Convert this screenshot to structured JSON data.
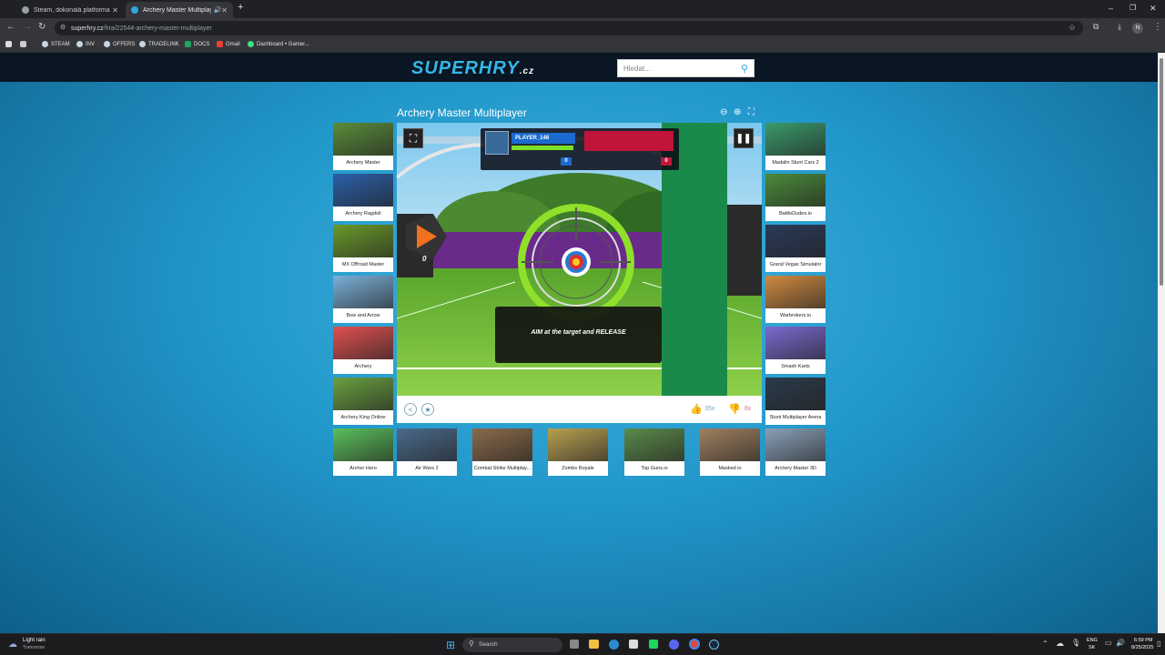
{
  "browser": {
    "tabs": [
      {
        "label": "Steam, dokonalá platforma pre",
        "active": false
      },
      {
        "label": "Archery Master Multiplaye",
        "active": true
      }
    ],
    "url_domain": "superhry.cz",
    "url_path": "/hra/22544-archery-master-multiplayer",
    "profile_initial": "N",
    "bookmarks": [
      "STEAM",
      "INV",
      "OFFERS",
      "TRADELINK",
      "DOCS",
      "Gmail",
      "Dashboard • Gamer..."
    ]
  },
  "site": {
    "logo": "SUPERHRY",
    "logo_suffix": ".cz",
    "search_placeholder": "Hledat..."
  },
  "game": {
    "title": "Archery Master Multiplayer",
    "player_name": "PLAYER_148",
    "player_score": "0",
    "opponent_score": "0",
    "left_counter": "0",
    "instruction": "AIM at the target and RELEASE",
    "likes": "35x",
    "dislikes": "8x"
  },
  "left_thumbs": [
    {
      "label": "Archery Master",
      "color": "#5a8c3a"
    },
    {
      "label": "Archery Ragdoll",
      "color": "#2a5fa8"
    },
    {
      "label": "MX Offroad Master",
      "color": "#6a9a2a"
    },
    {
      "label": "Bow and Arrow",
      "color": "#7ab0d8"
    },
    {
      "label": "Archery",
      "color": "#e05050"
    },
    {
      "label": "Archery King Online",
      "color": "#6aa040"
    }
  ],
  "right_thumbs": [
    {
      "label": "Madalin Stunt Cars 2",
      "color": "#3a9a6a"
    },
    {
      "label": "BattleDudes.io",
      "color": "#4a8a3a"
    },
    {
      "label": "Grand Vegas Simulator",
      "color": "#2a3a5a"
    },
    {
      "label": "Warbrokers.io",
      "color": "#d08a40"
    },
    {
      "label": "Smash Karts",
      "color": "#7a6ad0"
    },
    {
      "label": "Stunt Multiplayer Arena",
      "color": "#2a3a4a"
    }
  ],
  "bottom_thumbs": [
    {
      "label": "Archer Hero",
      "color": "#5ac05a"
    },
    {
      "label": "Air Wars 2",
      "color": "#4a6a8a"
    },
    {
      "label": "Combat Strike Multiplay...",
      "color": "#8a6a4a"
    },
    {
      "label": "Zombs Royale",
      "color": "#b8a050"
    },
    {
      "label": "Top Guns.io",
      "color": "#5a8a4a"
    },
    {
      "label": "Masked io",
      "color": "#a08060"
    },
    {
      "label": "Archery Master 3D",
      "color": "#8aa0b8"
    }
  ],
  "taskbar": {
    "weather_title": "Light rain",
    "weather_sub": "Tomorrow",
    "search_label": "Search",
    "lang_top": "ENG",
    "lang_bottom": "SK",
    "time": "6:59 PM",
    "date": "8/25/2025"
  }
}
